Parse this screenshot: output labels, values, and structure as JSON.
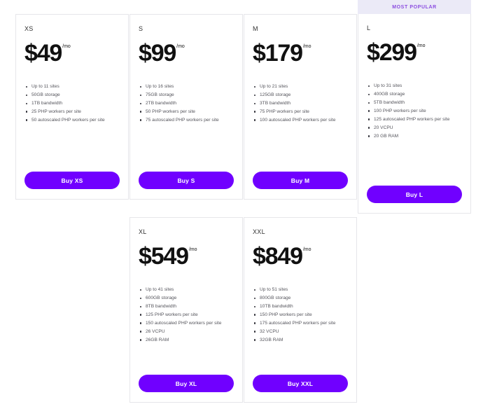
{
  "badge": {
    "most_popular": "MOST POPULAR"
  },
  "currency_symbol": "$",
  "period_suffix": "/mo",
  "rows": [
    {
      "plans": [
        {
          "name": "XS",
          "price": "$49",
          "period": "/mo",
          "featured": false,
          "features": [
            "Up to 11 sites",
            "50GB storage",
            "1TB bandwidth",
            "25 PHP workers per site",
            "50 autoscaled PHP workers per site"
          ],
          "cta": "Buy XS"
        },
        {
          "name": "S",
          "price": "$99",
          "period": "/mo",
          "featured": false,
          "features": [
            "Up to 16 sites",
            "75GB storage",
            "2TB bandwidth",
            "50 PHP workers per site",
            "75 autoscaled PHP workers per site"
          ],
          "cta": "Buy S"
        },
        {
          "name": "M",
          "price": "$179",
          "period": "/mo",
          "featured": false,
          "features": [
            "Up to 21 sites",
            "125GB storage",
            "3TB bandwidth",
            "75 PHP workers per site",
            "100 autoscaled PHP workers per site"
          ],
          "cta": "Buy M"
        },
        {
          "name": "L",
          "price": "$299",
          "period": "/mo",
          "featured": true,
          "badge": "MOST POPULAR",
          "features": [
            "Up to 31 sites",
            "400GB storage",
            "5TB bandwidth",
            "100 PHP workers per site",
            "125 autoscaled PHP workers per site",
            "20 VCPU",
            "20 GB RAM"
          ],
          "cta": "Buy L"
        }
      ]
    },
    {
      "plans": [
        {
          "name": "XL",
          "price": "$549",
          "period": "/mo",
          "featured": false,
          "features": [
            "Up to 41 sites",
            "600GB storage",
            "8TB bandwidth",
            "125 PHP workers per site",
            "150 autoscaled PHP workers per site",
            "26 VCPU",
            "26GB RAM"
          ],
          "cta": "Buy XL"
        },
        {
          "name": "XXL",
          "price": "$849",
          "period": "/mo",
          "featured": false,
          "features": [
            "Up to 51 sites",
            "800GB storage",
            "10TB bandwidth",
            "150 PHP workers per site",
            "175 autoscaled PHP workers per site",
            "32 VCPU",
            "32GB RAM"
          ],
          "cta": "Buy XXL"
        }
      ]
    }
  ],
  "colors": {
    "cta_background": "#7000ff",
    "cta_text": "#ffffff",
    "badge_background": "#ebeaf7",
    "badge_text": "#8c4ee0",
    "card_border": "#e6e6ea",
    "feature_text": "#55555c",
    "price_text": "#111111",
    "page_background": "#ffffff"
  }
}
